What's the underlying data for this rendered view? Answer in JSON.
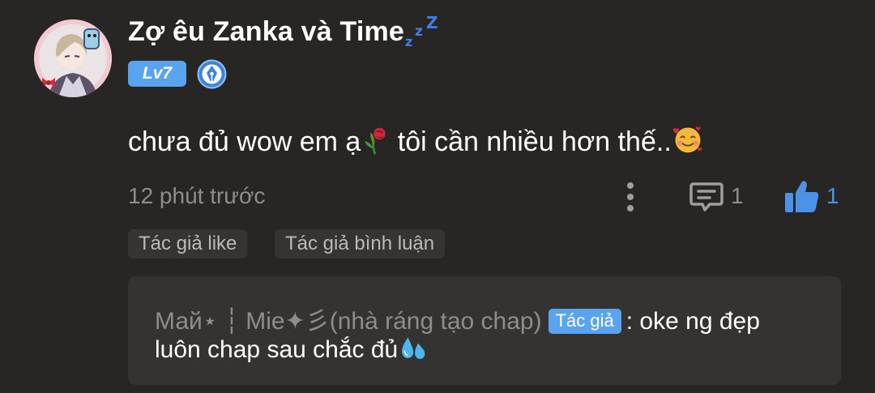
{
  "user": {
    "name": "Zợ êu Zanka và Time",
    "zzz": [
      "z",
      "z",
      "Z"
    ],
    "level": "Lv7",
    "avatar_icon": "anime-avatar-icon",
    "badge_icon": "pen-nib-badge-icon"
  },
  "comment": {
    "text_before_emoji": "chưa đủ wow em ạ",
    "emoji_1": "wilted-rose-emoji",
    "text_after_emoji": " tôi cần nhiều hơn thế..",
    "emoji_2": "smiling-face-with-hearts-emoji"
  },
  "meta": {
    "time": "12 phút trước",
    "reply_count": "1",
    "like_count": "1"
  },
  "tags": {
    "author_like": "Tác giả like",
    "author_comment": "Tác giả bình luận"
  },
  "reply": {
    "author": "Май⋆ ┆ Mie✦彡(nhà ráng tạo chap)",
    "author_badge": "Tác giả",
    "text_line1": ": oke ng đẹp",
    "text_line2": "luôn chap sau chắc đủ",
    "emoji": "sweat-droplets-emoji"
  },
  "colors": {
    "background": "#282624",
    "accent_blue": "#5aa3ee",
    "like_blue": "#4a93e6",
    "muted_text": "#8f8d8a",
    "reply_box": "#343332"
  }
}
